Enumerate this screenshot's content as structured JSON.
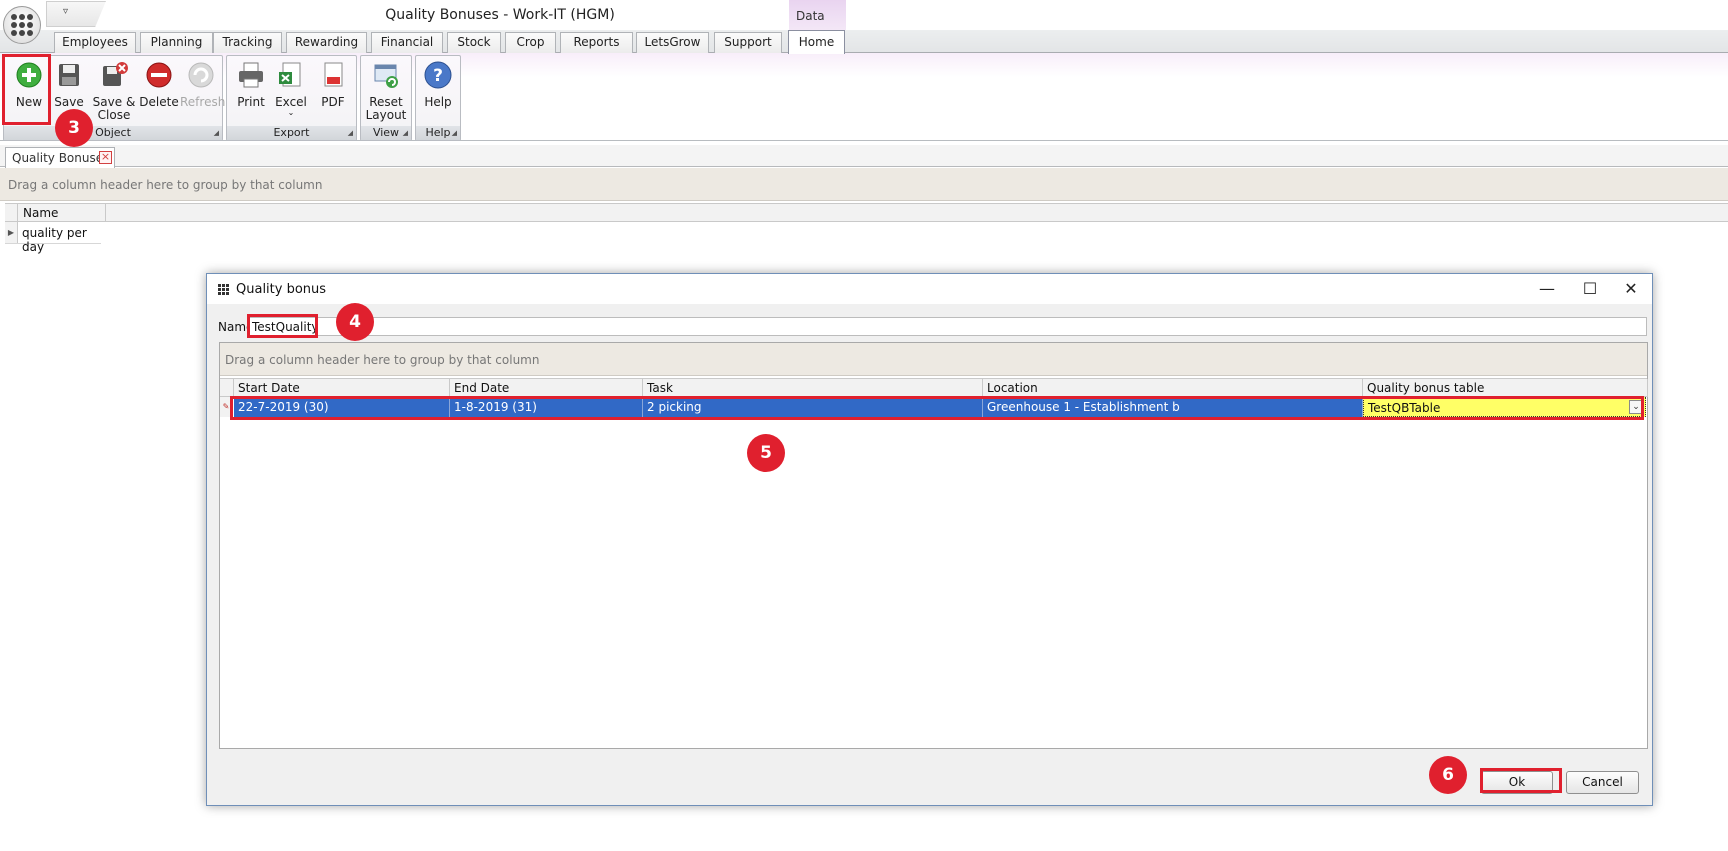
{
  "window": {
    "title": "Quality Bonuses - Work-IT (HGM)",
    "context_tab_header": "Data"
  },
  "ribbon_tabs": [
    "Employees",
    "Planning",
    "Tracking",
    "Rewarding",
    "Financial",
    "Stock",
    "Crop",
    "Reports",
    "LetsGrow",
    "Support",
    "Home"
  ],
  "active_tab": "Home",
  "ribbon": {
    "groups": {
      "object": {
        "label": "Object",
        "buttons": {
          "new": "New",
          "save": "Save",
          "save_close": "Save &\nClose",
          "delete": "Delete",
          "refresh": "Refresh"
        }
      },
      "export": {
        "label": "Export",
        "buttons": {
          "print": "Print",
          "excel": "Excel",
          "pdf": "PDF"
        }
      },
      "view": {
        "label": "View",
        "buttons": {
          "reset_layout": "Reset\nLayout"
        }
      },
      "help": {
        "label": "Help",
        "buttons": {
          "help": "Help"
        }
      }
    }
  },
  "document_tab": {
    "label": "Quality Bonuses"
  },
  "main_grid": {
    "group_hint": "Drag a column header here to group by that column",
    "columns": [
      "Name"
    ],
    "rows": [
      "quality per day"
    ]
  },
  "dialog": {
    "title": "Quality bonus",
    "name_label": "Name",
    "name_value": "TestQuality",
    "grid": {
      "group_hint": "Drag a column header here to group by that column",
      "columns": [
        "Start Date",
        "End Date",
        "Task",
        "Location",
        "Quality bonus table"
      ],
      "rows": [
        {
          "start_date": "22-7-2019 (30)",
          "end_date": "1-8-2019 (31)",
          "task": "2 picking",
          "location": "Greenhouse 1 - Establishment b",
          "quality_bonus_table": "TestQBTable"
        }
      ]
    },
    "buttons": {
      "ok": "Ok",
      "cancel": "Cancel"
    }
  },
  "steps": {
    "s3": "3",
    "s4": "4",
    "s5": "5",
    "s6": "6"
  },
  "colors": {
    "highlight": "#e0202e",
    "selection": "#3169c6",
    "editor_yellow": "#ffff66"
  }
}
